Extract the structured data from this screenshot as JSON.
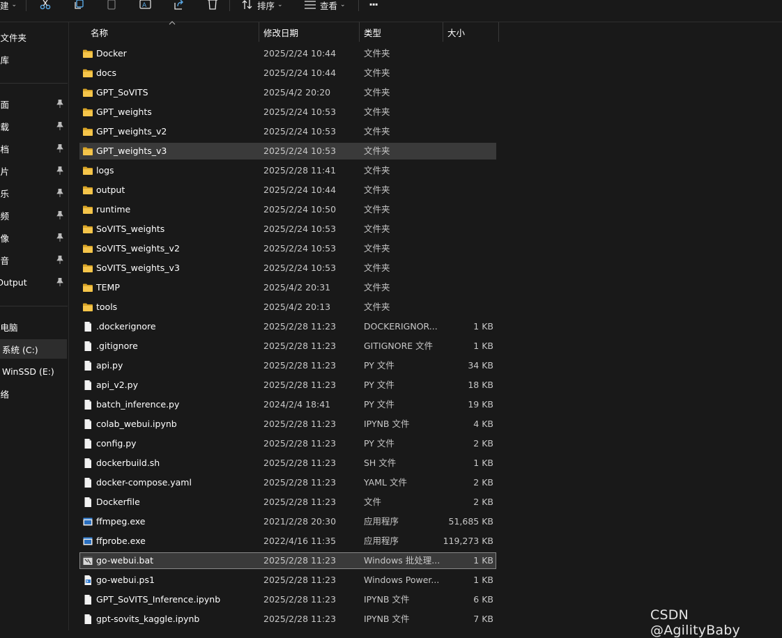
{
  "toolbar": {
    "new_label": "建",
    "sort_label": "排序",
    "view_label": "查看",
    "more_label": "···"
  },
  "sidebar": {
    "items": [
      {
        "label": "主文件夹",
        "pinned": false
      },
      {
        "label": "图库",
        "pinned": false
      },
      {
        "label": "桌面",
        "pinned": true
      },
      {
        "label": "下载",
        "pinned": true
      },
      {
        "label": "文档",
        "pinned": true
      },
      {
        "label": "图片",
        "pinned": true
      },
      {
        "label": "音乐",
        "pinned": true
      },
      {
        "label": "视频",
        "pinned": true
      },
      {
        "label": "摄像",
        "pinned": true
      },
      {
        "label": "录音",
        "pinned": true
      },
      {
        "label": "FOutput",
        "pinned": true
      },
      {
        "label": "此电脑",
        "pinned": false
      },
      {
        "label": "系统 (C:)",
        "pinned": false,
        "selected": true
      },
      {
        "label": "WinSSD (E:)",
        "pinned": false
      },
      {
        "label": "网络",
        "pinned": false
      }
    ]
  },
  "columns": {
    "name": "名称",
    "date": "修改日期",
    "type": "类型",
    "size": "大小"
  },
  "files": [
    {
      "name": "Docker",
      "date": "2025/2/24 10:44",
      "type": "文件夹",
      "size": "",
      "icon": "folder-icon"
    },
    {
      "name": "docs",
      "date": "2025/2/24 10:44",
      "type": "文件夹",
      "size": "",
      "icon": "folder-icon"
    },
    {
      "name": "GPT_SoVITS",
      "date": "2025/4/2 20:20",
      "type": "文件夹",
      "size": "",
      "icon": "folder-icon"
    },
    {
      "name": "GPT_weights",
      "date": "2025/2/24 10:53",
      "type": "文件夹",
      "size": "",
      "icon": "folder-icon"
    },
    {
      "name": "GPT_weights_v2",
      "date": "2025/2/24 10:53",
      "type": "文件夹",
      "size": "",
      "icon": "folder-icon"
    },
    {
      "name": "GPT_weights_v3",
      "date": "2025/2/24 10:53",
      "type": "文件夹",
      "size": "",
      "icon": "folder-icon",
      "state": "hover"
    },
    {
      "name": "logs",
      "date": "2025/2/28 11:41",
      "type": "文件夹",
      "size": "",
      "icon": "folder-icon"
    },
    {
      "name": "output",
      "date": "2025/2/24 10:44",
      "type": "文件夹",
      "size": "",
      "icon": "folder-icon"
    },
    {
      "name": "runtime",
      "date": "2025/2/24 10:50",
      "type": "文件夹",
      "size": "",
      "icon": "folder-icon"
    },
    {
      "name": "SoVITS_weights",
      "date": "2025/2/24 10:53",
      "type": "文件夹",
      "size": "",
      "icon": "folder-icon"
    },
    {
      "name": "SoVITS_weights_v2",
      "date": "2025/2/24 10:53",
      "type": "文件夹",
      "size": "",
      "icon": "folder-icon"
    },
    {
      "name": "SoVITS_weights_v3",
      "date": "2025/2/24 10:53",
      "type": "文件夹",
      "size": "",
      "icon": "folder-icon"
    },
    {
      "name": "TEMP",
      "date": "2025/4/2 20:31",
      "type": "文件夹",
      "size": "",
      "icon": "folder-icon"
    },
    {
      "name": "tools",
      "date": "2025/4/2 20:13",
      "type": "文件夹",
      "size": "",
      "icon": "folder-icon"
    },
    {
      "name": ".dockerignore",
      "date": "2025/2/28 11:23",
      "type": "DOCKERIGNOR...",
      "size": "1 KB",
      "icon": "file-icon"
    },
    {
      "name": ".gitignore",
      "date": "2025/2/28 11:23",
      "type": "GITIGNORE 文件",
      "size": "1 KB",
      "icon": "file-icon"
    },
    {
      "name": "api.py",
      "date": "2025/2/28 11:23",
      "type": "PY 文件",
      "size": "34 KB",
      "icon": "file-icon"
    },
    {
      "name": "api_v2.py",
      "date": "2025/2/28 11:23",
      "type": "PY 文件",
      "size": "18 KB",
      "icon": "file-icon"
    },
    {
      "name": "batch_inference.py",
      "date": "2024/2/4 18:41",
      "type": "PY 文件",
      "size": "19 KB",
      "icon": "file-icon"
    },
    {
      "name": "colab_webui.ipynb",
      "date": "2025/2/28 11:23",
      "type": "IPYNB 文件",
      "size": "4 KB",
      "icon": "file-icon"
    },
    {
      "name": "config.py",
      "date": "2025/2/28 11:23",
      "type": "PY 文件",
      "size": "2 KB",
      "icon": "file-icon"
    },
    {
      "name": "dockerbuild.sh",
      "date": "2025/2/28 11:23",
      "type": "SH 文件",
      "size": "1 KB",
      "icon": "file-icon"
    },
    {
      "name": "docker-compose.yaml",
      "date": "2025/2/28 11:23",
      "type": "YAML 文件",
      "size": "2 KB",
      "icon": "file-icon"
    },
    {
      "name": "Dockerfile",
      "date": "2025/2/28 11:23",
      "type": "文件",
      "size": "2 KB",
      "icon": "file-icon"
    },
    {
      "name": "ffmpeg.exe",
      "date": "2021/2/28 20:30",
      "type": "应用程序",
      "size": "51,685 KB",
      "icon": "exe-icon"
    },
    {
      "name": "ffprobe.exe",
      "date": "2022/4/16 11:35",
      "type": "应用程序",
      "size": "119,273 KB",
      "icon": "exe-icon"
    },
    {
      "name": "go-webui.bat",
      "date": "2025/2/28 11:23",
      "type": "Windows 批处理...",
      "size": "1 KB",
      "icon": "bat-icon",
      "state": "focused"
    },
    {
      "name": "go-webui.ps1",
      "date": "2025/2/28 11:23",
      "type": "Windows Power...",
      "size": "1 KB",
      "icon": "ps1-icon"
    },
    {
      "name": "GPT_SoVITS_Inference.ipynb",
      "date": "2025/2/28 11:23",
      "type": "IPYNB 文件",
      "size": "6 KB",
      "icon": "file-icon"
    },
    {
      "name": "gpt-sovits_kaggle.ipynb",
      "date": "2025/2/28 11:23",
      "type": "IPYNB 文件",
      "size": "7 KB",
      "icon": "file-icon"
    }
  ],
  "watermark": "CSDN @AgilityBaby",
  "colors": {
    "folder": "#f5c54a",
    "folder_back": "#d9a528",
    "file": "#f2f2f2",
    "hover": "#3a3a3a"
  }
}
